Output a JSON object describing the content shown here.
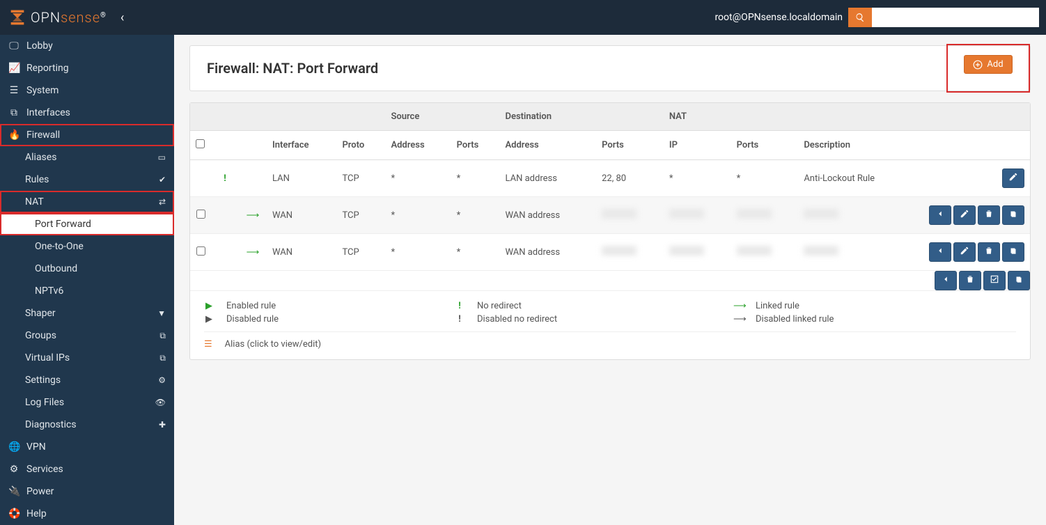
{
  "header": {
    "brand": "OPNsense",
    "user": "root@OPNsense.localdomain",
    "search_placeholder": ""
  },
  "sidebar": {
    "lobby": "Lobby",
    "reporting": "Reporting",
    "system": "System",
    "interfaces": "Interfaces",
    "firewall": "Firewall",
    "aliases": "Aliases",
    "rules": "Rules",
    "nat": "NAT",
    "port_forward": "Port Forward",
    "one_to_one": "One-to-One",
    "outbound": "Outbound",
    "nptv6": "NPTv6",
    "shaper": "Shaper",
    "groups": "Groups",
    "virtual_ips": "Virtual IPs",
    "settings": "Settings",
    "log_files": "Log Files",
    "diagnostics": "Diagnostics",
    "vpn": "VPN",
    "services": "Services",
    "power": "Power",
    "help": "Help"
  },
  "page": {
    "title": "Firewall: NAT: Port Forward",
    "add_label": "Add"
  },
  "table": {
    "groups": {
      "source": "Source",
      "destination": "Destination",
      "nat": "NAT"
    },
    "cols": {
      "interface": "Interface",
      "proto": "Proto",
      "src_addr": "Address",
      "src_ports": "Ports",
      "dest_addr": "Address",
      "dest_ports": "Ports",
      "nat_ip": "IP",
      "nat_ports": "Ports",
      "description": "Description"
    },
    "rows": [
      {
        "checkbox": false,
        "status": "warn",
        "link": null,
        "interface": "LAN",
        "proto": "TCP",
        "src_addr": "*",
        "src_ports": "*",
        "dest_addr": "LAN address",
        "dest_ports": "22, 80",
        "nat_ip": "*",
        "nat_ports": "*",
        "description": "Anti-Lockout Rule",
        "actions": [
          "edit"
        ]
      },
      {
        "checkbox": true,
        "status": null,
        "link": "linked",
        "interface": "WAN",
        "proto": "TCP",
        "src_addr": "*",
        "src_ports": "*",
        "dest_addr": "WAN address",
        "dest_ports": "",
        "nat_ip": "",
        "nat_ports": "",
        "description": "",
        "actions": [
          "left",
          "edit",
          "trash",
          "copy"
        ]
      },
      {
        "checkbox": true,
        "status": null,
        "link": "linked",
        "interface": "WAN",
        "proto": "TCP",
        "src_addr": "*",
        "src_ports": "*",
        "dest_addr": "WAN address",
        "dest_ports": "",
        "nat_ip": "",
        "nat_ports": "",
        "description": "",
        "actions": [
          "left",
          "edit",
          "trash",
          "copy"
        ]
      }
    ],
    "footer_actions": [
      "left",
      "trash",
      "check",
      "copy"
    ]
  },
  "legend": {
    "enabled": "Enabled rule",
    "disabled": "Disabled rule",
    "no_redirect": "No redirect",
    "disabled_no_redirect": "Disabled no redirect",
    "linked": "Linked rule",
    "disabled_linked": "Disabled linked rule",
    "alias": "Alias (click to view/edit)"
  }
}
